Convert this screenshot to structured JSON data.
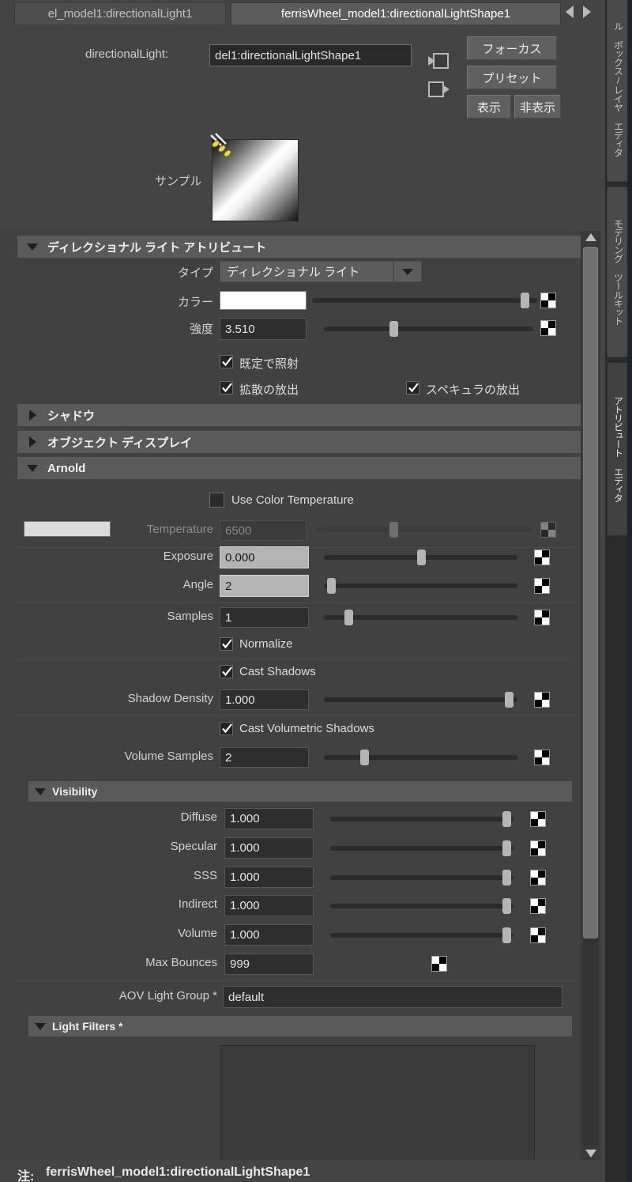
{
  "window": {
    "tabs": [
      {
        "label": "el_model1:directionalLight1",
        "active": false
      },
      {
        "label": "ferrisWheel_model1:directionalLightShape1",
        "active": true
      }
    ],
    "nav_prev_icon": "triangle-left-icon",
    "nav_next_icon": "triangle-right-icon"
  },
  "header": {
    "node_type_label": "directionalLight:",
    "node_name": "del1:directionalLightShape1",
    "input_connection_icon": "input-connection-icon",
    "output_connection_icon": "output-connection-icon",
    "focus_button": "フォーカス",
    "preset_button": "プリセット",
    "show_button": "表示",
    "hide_button": "非表示"
  },
  "sample": {
    "label": "サンプル",
    "icon": "directional-light-icon"
  },
  "directional_light_attributes": {
    "title": "ディレクショナル ライト アトリビュート",
    "expanded": true,
    "type_label": "タイプ",
    "type_value": "ディレクショナル ライト",
    "color_label": "カラー",
    "color_value": "#ffffff",
    "color_slider_pct": 100,
    "intensity_label": "強度",
    "intensity_value": "3.510",
    "intensity_slider_pct": 26,
    "illuminate_default_label": "既定で照射",
    "illuminate_default_checked": true,
    "emit_diffuse_label": "拡散の放出",
    "emit_diffuse_checked": true,
    "emit_specular_label": "スペキュラの放出",
    "emit_specular_checked": true
  },
  "shadows_section": {
    "title": "シャドウ",
    "expanded": false
  },
  "object_display_section": {
    "title": "オブジェクト ディスプレイ",
    "expanded": false
  },
  "arnold": {
    "title": "Arnold",
    "expanded": true,
    "use_color_temperature_label": "Use Color Temperature",
    "use_color_temperature_checked": false,
    "temperature_label": "Temperature",
    "temperature_value": "6500",
    "temperature_slider_pct": 35,
    "temperature_disabled": true,
    "exposure_label": "Exposure",
    "exposure_value": "0.000",
    "exposure_slider_pct": 50,
    "exposure_highlighted": true,
    "angle_label": "Angle",
    "angle_value": "2",
    "angle_slider_pct": 2,
    "angle_highlighted": true,
    "samples_label": "Samples",
    "samples_value": "1",
    "samples_slider_pct": 10,
    "normalize_label": "Normalize",
    "normalize_checked": true,
    "cast_shadows_label": "Cast Shadows",
    "cast_shadows_checked": true,
    "shadow_density_label": "Shadow Density",
    "shadow_density_value": "1.000",
    "shadow_density_slider_pct": 98,
    "cast_volumetric_shadows_label": "Cast Volumetric Shadows",
    "cast_volumetric_shadows_checked": true,
    "volume_samples_label": "Volume Samples",
    "volume_samples_value": "2",
    "volume_samples_slider_pct": 19
  },
  "visibility": {
    "title": "Visibility",
    "expanded": true,
    "rows": [
      {
        "label": "Diffuse",
        "value": "1.000",
        "slider_pct": 97
      },
      {
        "label": "Specular",
        "value": "1.000",
        "slider_pct": 97
      },
      {
        "label": "SSS",
        "value": "1.000",
        "slider_pct": 97
      },
      {
        "label": "Indirect",
        "value": "1.000",
        "slider_pct": 97
      },
      {
        "label": "Volume",
        "value": "1.000",
        "slider_pct": 97
      }
    ],
    "max_bounces_label": "Max Bounces",
    "max_bounces_value": "999",
    "aov_light_group_label": "AOV Light Group *",
    "aov_light_group_value": "default"
  },
  "light_filters": {
    "title": "Light Filters *",
    "expanded": true,
    "items": []
  },
  "footer": {
    "note_label": "注:",
    "note_value": "ferrisWheel_model1:directionalLightShape1"
  },
  "side_tabs": [
    {
      "label": "ル ボックス/レイヤ エディタ",
      "active": false
    },
    {
      "label": "モデリング ツールキット",
      "active": false
    },
    {
      "label": "アトリビュート エディタ",
      "active": true
    }
  ]
}
